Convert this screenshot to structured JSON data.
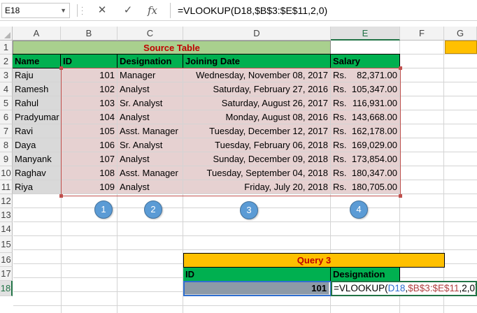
{
  "formula_bar": {
    "name_box": "E18",
    "cancel_icon": "✕",
    "enter_icon": "✓",
    "fx_label": "fx",
    "formula": "=VLOOKUP(D18,$B$3:$E$11,2,0)"
  },
  "columns": [
    "A",
    "B",
    "C",
    "D",
    "E",
    "F",
    "G"
  ],
  "rows": [
    "1",
    "2",
    "3",
    "4",
    "5",
    "6",
    "7",
    "8",
    "9",
    "10",
    "11",
    "12",
    "13",
    "14",
    "15",
    "16",
    "17",
    "18"
  ],
  "source_table": {
    "title": "Source Table",
    "headers": [
      "Name",
      "ID",
      "Designation",
      "Joining Date",
      "Salary"
    ],
    "rows": [
      {
        "name": "Raju",
        "id": "101",
        "designation": "Manager",
        "date": "Wednesday, November 08, 2017",
        "cur": "Rs.",
        "salary": "82,371.00"
      },
      {
        "name": "Ramesh",
        "id": "102",
        "designation": "Analyst",
        "date": "Saturday, February 27, 2016",
        "cur": "Rs.",
        "salary": "105,347.00"
      },
      {
        "name": "Rahul",
        "id": "103",
        "designation": "Sr. Analyst",
        "date": "Saturday, August 26, 2017",
        "cur": "Rs.",
        "salary": "116,931.00"
      },
      {
        "name": "Pradyumar",
        "id": "104",
        "designation": "Analyst",
        "date": "Monday, August 08, 2016",
        "cur": "Rs.",
        "salary": "143,668.00"
      },
      {
        "name": "Ravi",
        "id": "105",
        "designation": "Asst. Manager",
        "date": "Tuesday, December 12, 2017",
        "cur": "Rs.",
        "salary": "162,178.00"
      },
      {
        "name": "Daya",
        "id": "106",
        "designation": "Sr. Analyst",
        "date": "Tuesday, February 06, 2018",
        "cur": "Rs.",
        "salary": "169,029.00"
      },
      {
        "name": "Manyank",
        "id": "107",
        "designation": "Analyst",
        "date": "Sunday, December 09, 2018",
        "cur": "Rs.",
        "salary": "173,854.00"
      },
      {
        "name": "Raghav",
        "id": "108",
        "designation": "Asst. Manager",
        "date": "Tuesday, September 04, 2018",
        "cur": "Rs.",
        "salary": "180,347.00"
      },
      {
        "name": "Riya",
        "id": "109",
        "designation": "Analyst",
        "date": "Friday, July 20, 2018",
        "cur": "Rs.",
        "salary": "180,705.00"
      }
    ]
  },
  "callouts": [
    "1",
    "2",
    "3",
    "4"
  ],
  "query": {
    "title": "Query 3",
    "headers": [
      "ID",
      "Designation"
    ],
    "id_value": "101",
    "formula_parts": {
      "prefix": "=VLOOKUP(",
      "ref": "D18",
      "comma1": ",",
      "range": "$B$3:$E$11",
      "suffix": ",2,0)"
    }
  },
  "colors": {
    "header_green": "#00b050",
    "title_green": "#a9d08e",
    "query_orange": "#ffc000",
    "title_red": "#c00000",
    "data_pink": "#e6d1d1",
    "name_gray": "#d9d9d9",
    "callout_blue": "#5b9bd5"
  }
}
